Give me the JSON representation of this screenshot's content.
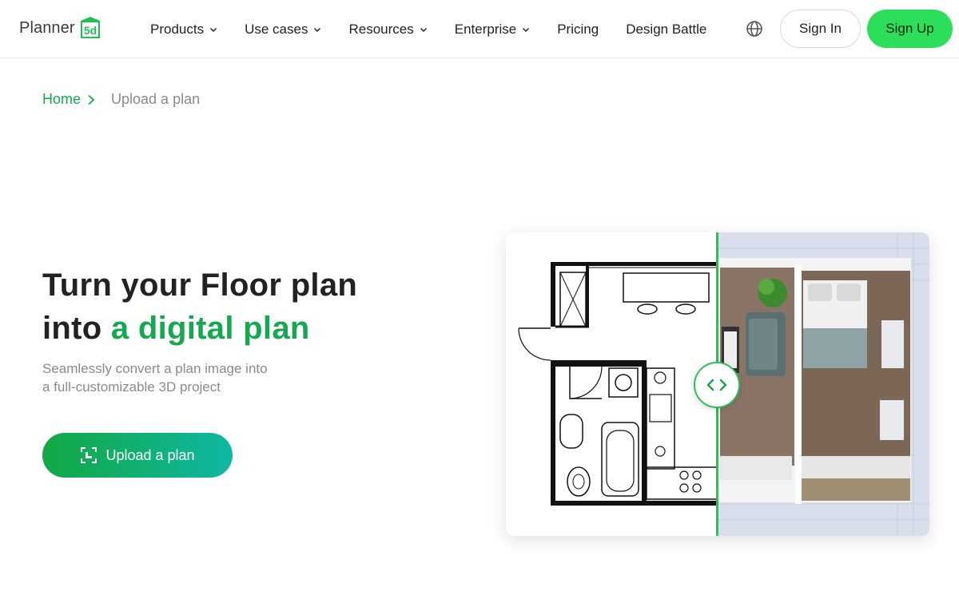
{
  "header": {
    "logo_text": "Planner",
    "logo_badge": "5d",
    "nav": [
      {
        "label": "Products",
        "has_dropdown": true
      },
      {
        "label": "Use cases",
        "has_dropdown": true
      },
      {
        "label": "Resources",
        "has_dropdown": true
      },
      {
        "label": "Enterprise",
        "has_dropdown": true
      },
      {
        "label": "Pricing",
        "has_dropdown": false
      },
      {
        "label": "Design Battle",
        "has_dropdown": false
      }
    ],
    "language_icon": "globe-icon",
    "signin_label": "Sign In",
    "signup_label": "Sign Up"
  },
  "breadcrumb": {
    "home": "Home",
    "current": "Upload a plan"
  },
  "hero": {
    "title_line1": "Turn your Floor plan",
    "title_line2_prefix": "into ",
    "title_line2_accent": "a digital plan",
    "subtitle_line1": "Seamlessly convert a plan image into",
    "subtitle_line2": "a full-customizable 3D project",
    "upload_button": "Upload a plan"
  },
  "colors": {
    "brand_green": "#2dde5b",
    "accent_green": "#16a84e",
    "gradient_start": "#12a843",
    "gradient_end": "#0fb7a4",
    "link_green": "#18a84a"
  },
  "comparison_slider": {
    "icon": "compare-arrows-icon",
    "left_view": "2D floor plan",
    "right_view": "3D render"
  }
}
